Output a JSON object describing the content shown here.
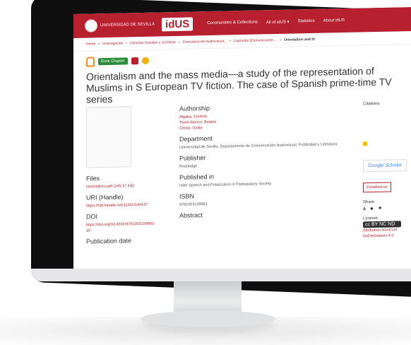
{
  "header": {
    "university": "UNIVERSIDAD DE SEVILLA",
    "repo": "idUS",
    "nav": [
      "Communities & Collections",
      "All of idUS ▾",
      "Statistics",
      "About idUS"
    ]
  },
  "breadcrumb": [
    "Home",
    "Investigación",
    "Ciencias Sociales y Jurídicas",
    "Comunicación Audiovisual...",
    "Capítulos (Comunicación ...",
    "Orientalism and th"
  ],
  "badges": {
    "type": "Book Chapter"
  },
  "title": "Orientalism and the mass media—a study of the representation of Muslims in S European TV fiction. The case of Spanish prime-time TV series",
  "left": {
    "files_h": "Files",
    "file_link": "Orientalism.pdf (145.37 KB)",
    "uri_h": "URI (Handle)",
    "uri": "https://hdl.handle.net/11441/144157",
    "doi_h": "DOI",
    "doi": "https://doi.org/10.4324/9781003109891-18",
    "pubdate_h": "Publication date"
  },
  "middle": {
    "authorship_h": "Authorship",
    "authors": [
      "Algaba, Cristina",
      "Tomé-Alonso, Beatriz",
      "Cimini, Giulia"
    ],
    "dept_h": "Department",
    "dept": "Universidad de Sevilla. Departamento de Comunicación Audiovisual, Publicidad y Literatura",
    "publisher_h": "Publisher",
    "publisher": "Routledge",
    "published_in_h": "Published in",
    "published_in": "Hate Speech and Polarization in Participatory Society",
    "isbn_h": "ISBN",
    "isbn": "9781003109891",
    "abstract_h": "Abstract"
  },
  "right": {
    "citations_h": "Citations",
    "google_scholar": "Google Scholar",
    "stats": "Estadísticas",
    "share_h": "Share",
    "license_h": "License",
    "license_text": "Attribution-NonCom NoDerivatives 4.0"
  },
  "icons": [
    "search-icon",
    "pdf-icon"
  ]
}
